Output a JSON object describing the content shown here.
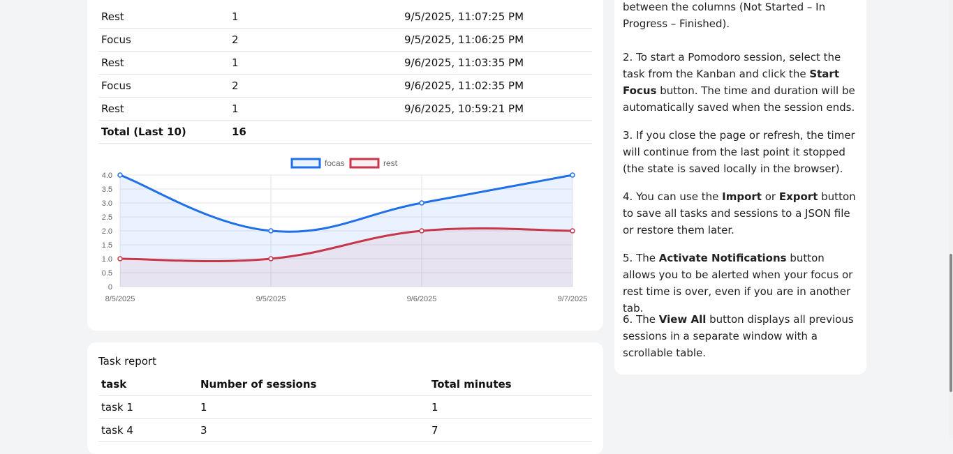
{
  "sessions": {
    "rows": [
      {
        "type": "Rest",
        "minutes": "1",
        "date": "9/5/2025, 11:07:25 PM"
      },
      {
        "type": "Focus",
        "minutes": "2",
        "date": "9/5/2025, 11:06:25 PM"
      },
      {
        "type": "Rest",
        "minutes": "1",
        "date": "9/6/2025, 11:03:35 PM"
      },
      {
        "type": "Focus",
        "minutes": "2",
        "date": "9/6/2025, 11:02:35 PM"
      },
      {
        "type": "Rest",
        "minutes": "1",
        "date": "9/6/2025, 10:59:21 PM"
      }
    ],
    "total_label": "Total (Last 10)",
    "total_value": "16"
  },
  "chart_data": {
    "type": "line",
    "categories": [
      "8/5/2025",
      "9/5/2025",
      "9/6/2025",
      "9/7/2025"
    ],
    "series": [
      {
        "name": "focas",
        "values": [
          4,
          2,
          3,
          4
        ],
        "color": "#1f6feb",
        "fill": "rgba(54,132,255,0.10)"
      },
      {
        "name": "rest",
        "values": [
          1,
          1,
          2,
          2
        ],
        "color": "#c8364a",
        "fill": "rgba(200,54,74,0.08)"
      }
    ],
    "ylim": [
      0,
      4
    ],
    "yticks": [
      "0",
      "0.5",
      "1.0",
      "1.5",
      "2.0",
      "2.5",
      "3.0",
      "3.5",
      "4.0"
    ],
    "legend": "top-center",
    "grid": true
  },
  "task_report": {
    "title": "Task report",
    "headers": [
      "task",
      "Number of sessions",
      "Total minutes"
    ],
    "rows": [
      [
        "task 1",
        "1",
        "1"
      ],
      [
        "task 4",
        "3",
        "7"
      ]
    ]
  },
  "help": {
    "p1": "between the columns (Not Started – In Progress – Finished).",
    "p2_a": "2. To start a Pomodoro session, select the task from the Kanban and click the ",
    "p2_b": "Start Focus",
    "p2_c": " button. The time and duration will be automatically saved when the session ends.",
    "p3": "3. If you close the page or refresh, the timer will continue from the last point it stopped (the state is saved locally in the browser).",
    "p4_a": "4. You can use the ",
    "p4_b": "Import",
    "p4_c": " or ",
    "p4_d": "Export",
    "p4_e": " button to save all tasks and sessions to a JSON file or restore them later.",
    "p5_a": "5. The ",
    "p5_b": "Activate Notifications",
    "p5_c": " button allows you to be alerted when your focus or rest time is over, even if you are in another tab.",
    "p6_a": "6. The ",
    "p6_b": "View All",
    "p6_c": " button displays all previous sessions in a separate window with a scrollable table."
  }
}
